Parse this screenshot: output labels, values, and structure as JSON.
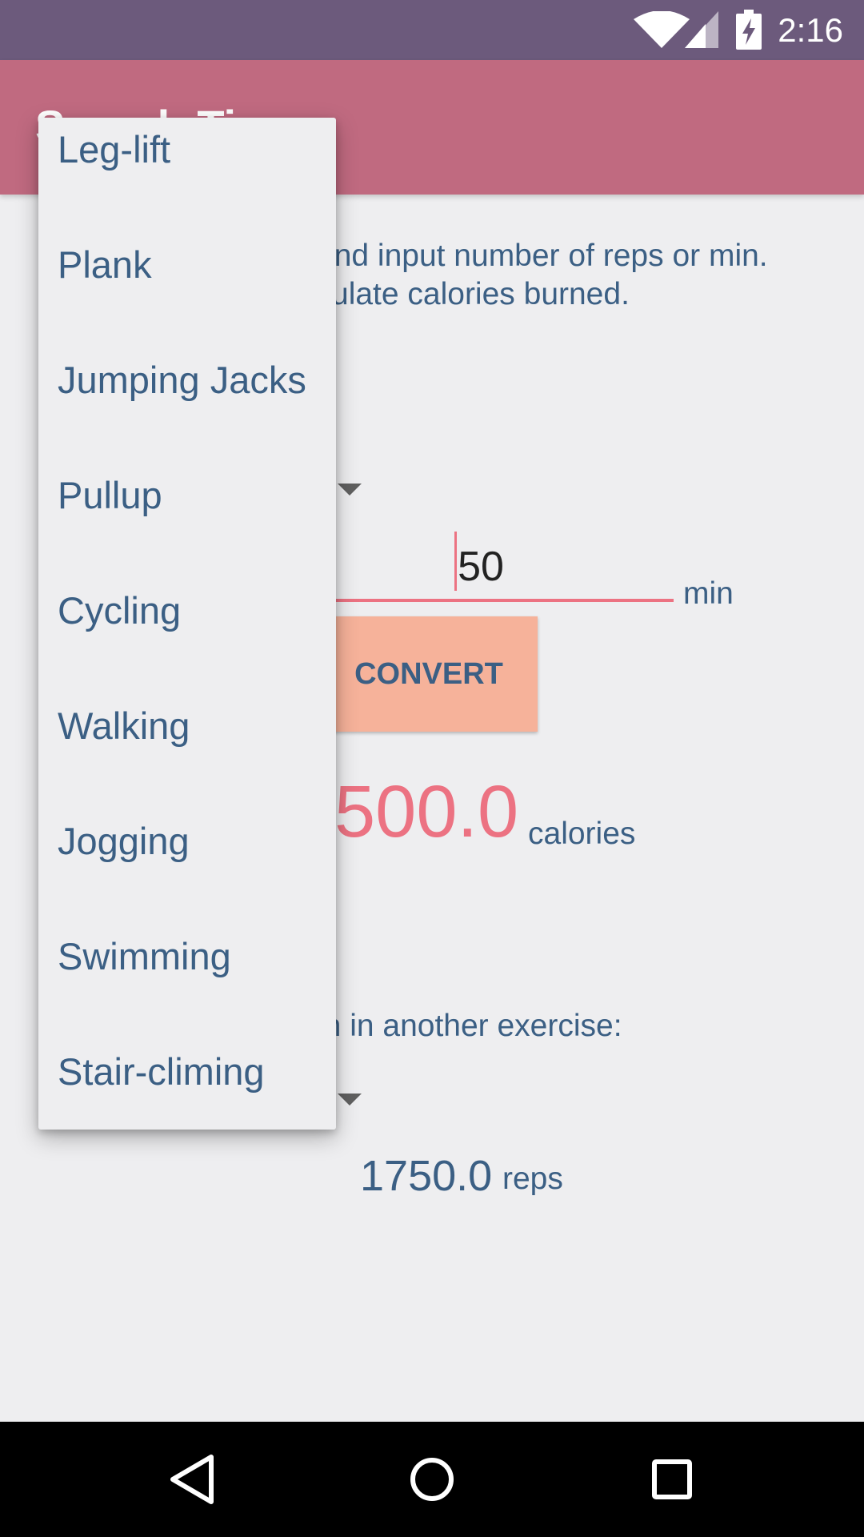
{
  "status_bar": {
    "time": "2:16"
  },
  "app_bar": {
    "title": "Search Time"
  },
  "instructions": {
    "line1": "and input number of reps or min.",
    "line2": "ulate calories burned."
  },
  "input": {
    "value": "50",
    "unit": "min"
  },
  "convert_button": {
    "label": "CONVERT"
  },
  "result": {
    "value": "500.0",
    "unit": "calories"
  },
  "second_prompt": "in in another exercise:",
  "second_result": {
    "value": "1750.0",
    "unit": "reps"
  },
  "dropdown": {
    "items": [
      "Leg-lift",
      "Plank",
      "Jumping Jacks",
      "Pullup",
      "Cycling",
      "Walking",
      "Jogging",
      "Swimming",
      "Stair-climing"
    ]
  },
  "colors": {
    "status_bar": "#6c5a7c",
    "app_bar": "#c06a80",
    "accent": "#ec7282",
    "button": "#f6b29a",
    "text": "#3b5f84",
    "background": "#eeeef0"
  },
  "icons": {
    "status": [
      "wifi-icon",
      "signal-icon",
      "battery-charging-icon"
    ],
    "nav": [
      "back-icon",
      "home-icon",
      "recents-icon"
    ]
  }
}
